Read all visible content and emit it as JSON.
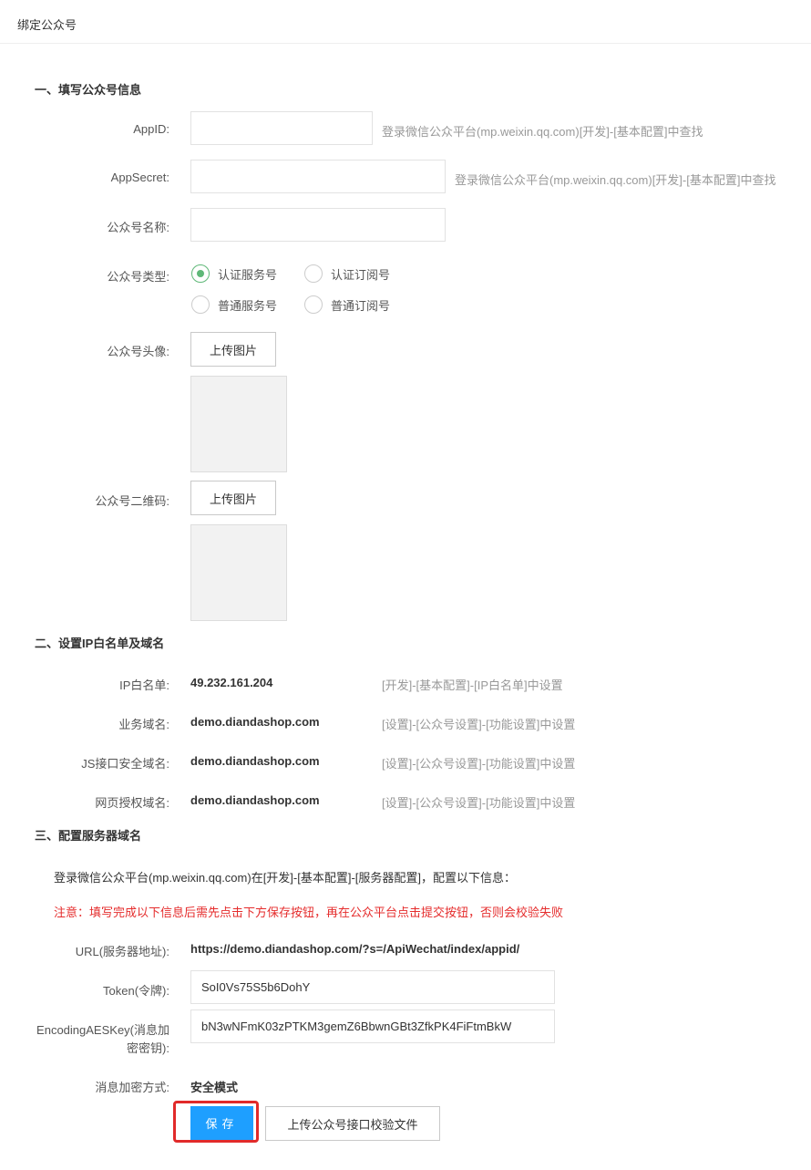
{
  "header": {
    "title": "绑定公众号"
  },
  "section1": {
    "title": "一、填写公众号信息",
    "appid": {
      "label": "AppID:",
      "value": "",
      "hint": "登录微信公众平台(mp.weixin.qq.com)[开发]-[基本配置]中查找"
    },
    "appsecret": {
      "label": "AppSecret:",
      "value": "",
      "hint": "登录微信公众平台(mp.weixin.qq.com)[开发]-[基本配置]中查找"
    },
    "name": {
      "label": "公众号名称:",
      "value": ""
    },
    "type": {
      "label": "公众号类型:",
      "options": [
        "认证服务号",
        "认证订阅号",
        "普通服务号",
        "普通订阅号"
      ],
      "selected": "认证服务号"
    },
    "avatar": {
      "label": "公众号头像:",
      "button": "上传图片"
    },
    "qrcode": {
      "label": "公众号二维码:",
      "button": "上传图片"
    }
  },
  "section2": {
    "title": "二、设置IP白名单及域名",
    "rows": [
      {
        "label": "IP白名单:",
        "value": "49.232.161.204",
        "hint": "[开发]-[基本配置]-[IP白名单]中设置"
      },
      {
        "label": "业务域名:",
        "value": "demo.diandashop.com",
        "hint": "[设置]-[公众号设置]-[功能设置]中设置"
      },
      {
        "label": "JS接口安全域名:",
        "value": "demo.diandashop.com",
        "hint": "[设置]-[公众号设置]-[功能设置]中设置"
      },
      {
        "label": "网页授权域名:",
        "value": "demo.diandashop.com",
        "hint": "[设置]-[公众号设置]-[功能设置]中设置"
      }
    ]
  },
  "section3": {
    "title": "三、配置服务器域名",
    "info": "登录微信公众平台(mp.weixin.qq.com)在[开发]-[基本配置]-[服务器配置]，配置以下信息：",
    "warning": "注意：填写完成以下信息后需先点击下方保存按钮，再在公众平台点击提交按钮，否则会校验失败",
    "url": {
      "label": "URL(服务器地址):",
      "value": "https://demo.diandashop.com/?s=/ApiWechat/index/appid/"
    },
    "token": {
      "label": "Token(令牌):",
      "value": "SoI0Vs75S5b6DohY"
    },
    "aeskey": {
      "label_line1": "EncodingAESKey(消息加",
      "label_line2": "密密钥):",
      "value": "bN3wNFmK03zPTKM3gemZ6BbwnGBt3ZfkPK4FiFtmBkW"
    },
    "encrypt": {
      "label": "消息加密方式:",
      "value": "安全模式"
    }
  },
  "actions": {
    "save": "保存",
    "upload_verify": "上传公众号接口校验文件"
  },
  "colors": {
    "primary": "#1e9fff",
    "radio_checked": "#5fb878",
    "warning": "#e52d2d",
    "highlight_border": "#e12a2a"
  }
}
